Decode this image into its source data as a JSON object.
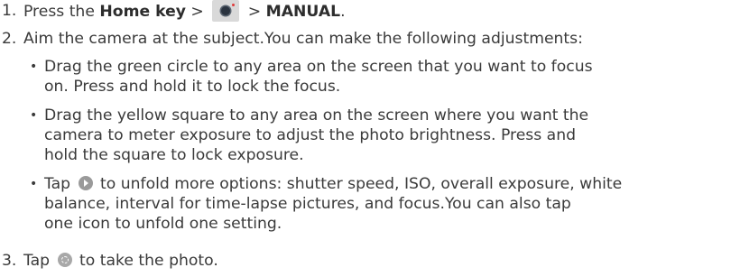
{
  "steps": [
    {
      "number": "1.",
      "text_a": "Press the ",
      "bold_a": "Home key",
      "text_b": " > ",
      "text_c": " > ",
      "bold_b": "MANUAL",
      "text_d": "."
    },
    {
      "number": "2.",
      "text": "Aim the camera at the subject.You can make the following adjustments:",
      "bullets": [
        {
          "dot": "•",
          "lines": [
            "Drag the green circle to any area on the screen that you want to focus",
            "on. Press and hold it to lock the focus."
          ]
        },
        {
          "dot": "•",
          "lines": [
            "Drag the yellow square to any area on the screen where you want the",
            "camera to meter exposure to adjust the photo brightness. Press and",
            "hold the square to lock exposure."
          ]
        },
        {
          "dot": "•",
          "line1_a": "Tap ",
          "line1_b": " to unfold more options: shutter speed, ISO, overall exposure, white",
          "lines_rest": [
            "balance, interval for time-lapse pictures, and focus.You can also tap",
            "one icon to unfold one setting."
          ]
        }
      ]
    },
    {
      "number": "3.",
      "text_a": "Tap ",
      "text_b": " to take the photo."
    }
  ],
  "icons": {
    "camera": "camera-app-icon",
    "unfold": "unfold-arrow-icon",
    "shutter": "shutter-icon"
  }
}
